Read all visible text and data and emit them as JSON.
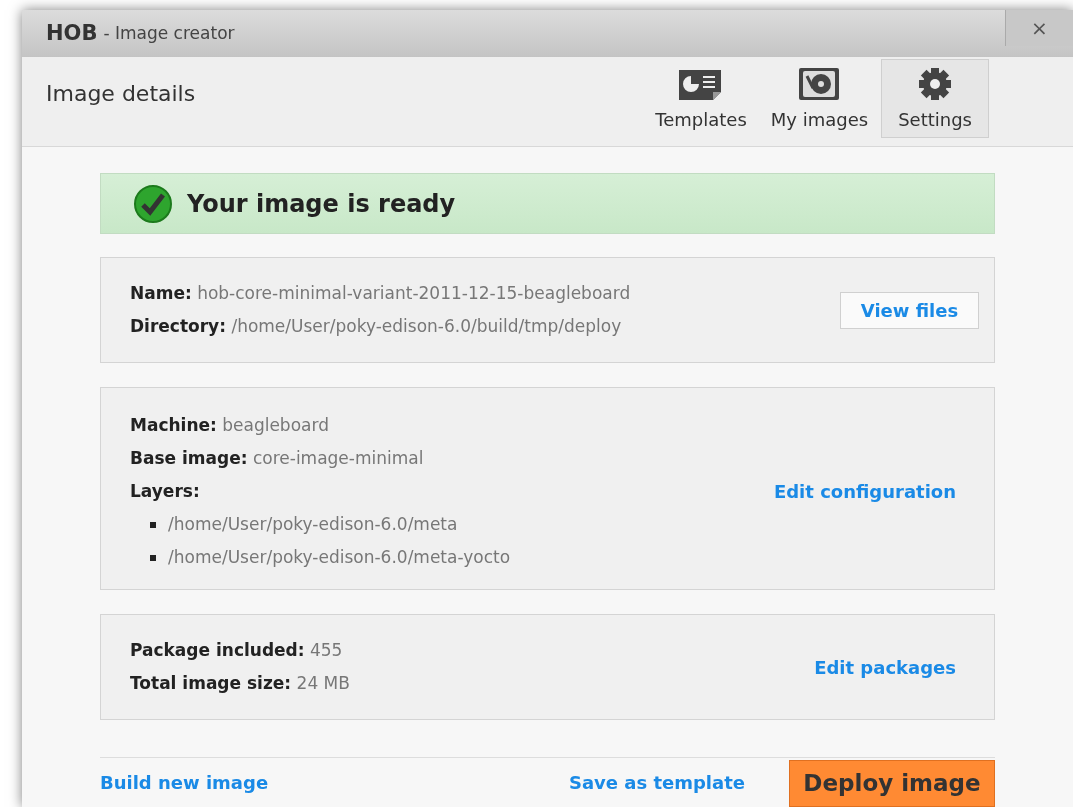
{
  "window": {
    "app": "HOB",
    "title": "- Image creator",
    "close": "×"
  },
  "header": {
    "title": "Image details",
    "tabs": [
      {
        "kind": "templates",
        "label": "Templates",
        "selected": false
      },
      {
        "kind": "images",
        "label": "My images",
        "selected": false
      },
      {
        "kind": "settings",
        "label": "Settings",
        "selected": true
      }
    ]
  },
  "status": {
    "message": "Your image is ready"
  },
  "cards": [
    {
      "fields": [
        {
          "label": "Name:",
          "value": "hob-core-minimal-variant-2011-12-15-beagleboard"
        },
        {
          "label": "Directory:",
          "value": "/home/User/poky-edison-6.0/build/tmp/deploy"
        }
      ],
      "action": {
        "kind": "button",
        "label": "View files"
      }
    },
    {
      "fields": [
        {
          "label": "Machine:",
          "value": "beagleboard"
        },
        {
          "label": "Base image:",
          "value": "core-image-minimal"
        },
        {
          "label": "Layers:"
        }
      ],
      "layers": [
        "/home/User/poky-edison-6.0/meta",
        "/home/User/poky-edison-6.0/meta-yocto"
      ],
      "action": {
        "kind": "link",
        "label": "Edit configuration"
      }
    },
    {
      "fields": [
        {
          "label": "Package included:",
          "value": "455"
        },
        {
          "label": "Total image size:",
          "value": "24 MB"
        }
      ],
      "action": {
        "kind": "link",
        "label": "Edit packages"
      }
    }
  ],
  "footer": {
    "build_link": "Build new image",
    "save_link": "Save as template",
    "deploy_button": "Deploy image"
  }
}
